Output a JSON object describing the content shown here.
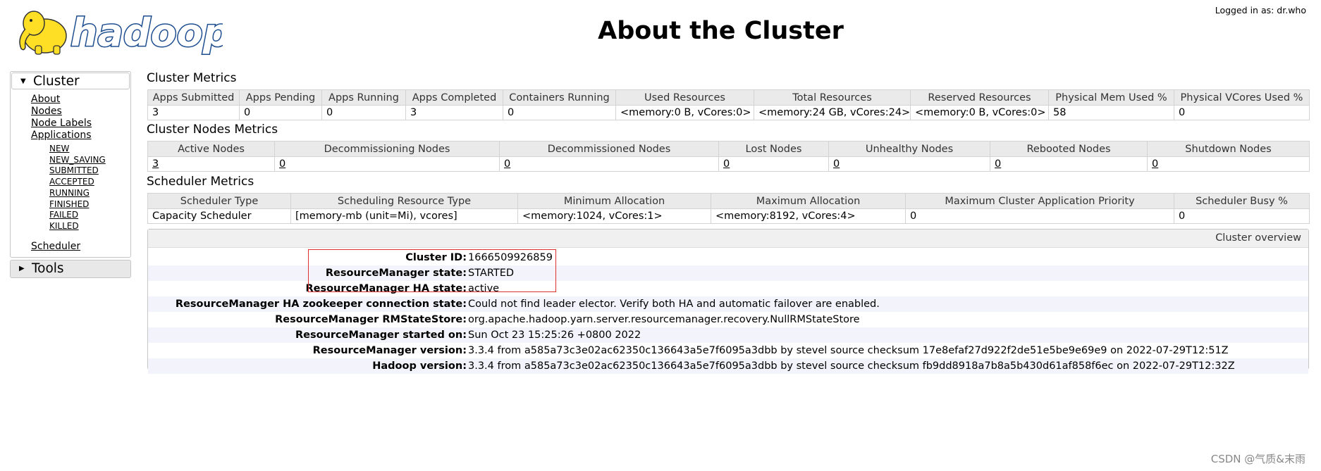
{
  "header": {
    "logo_text": "hadoop",
    "title": "About the Cluster",
    "logged_in": "Logged in as: dr.who"
  },
  "sidebar": {
    "cluster_label": "Cluster",
    "links": [
      "About",
      "Nodes",
      "Node Labels",
      "Applications"
    ],
    "app_states": [
      "NEW",
      "NEW_SAVING",
      "SUBMITTED",
      "ACCEPTED",
      "RUNNING",
      "FINISHED",
      "FAILED",
      "KILLED"
    ],
    "scheduler_label": "Scheduler",
    "tools_label": "Tools"
  },
  "cluster_metrics": {
    "title": "Cluster Metrics",
    "headers": [
      "Apps Submitted",
      "Apps Pending",
      "Apps Running",
      "Apps Completed",
      "Containers Running",
      "Used Resources",
      "Total Resources",
      "Reserved Resources",
      "Physical Mem Used %",
      "Physical VCores Used %"
    ],
    "values": [
      "3",
      "0",
      "0",
      "3",
      "0",
      "<memory:0 B, vCores:0>",
      "<memory:24 GB, vCores:24>",
      "<memory:0 B, vCores:0>",
      "58",
      "0"
    ]
  },
  "node_metrics": {
    "title": "Cluster Nodes Metrics",
    "headers": [
      "Active Nodes",
      "Decommissioning Nodes",
      "Decommissioned Nodes",
      "Lost Nodes",
      "Unhealthy Nodes",
      "Rebooted Nodes",
      "Shutdown Nodes"
    ],
    "values": [
      "3",
      "0",
      "0",
      "0",
      "0",
      "0",
      "0"
    ]
  },
  "scheduler_metrics": {
    "title": "Scheduler Metrics",
    "headers": [
      "Scheduler Type",
      "Scheduling Resource Type",
      "Minimum Allocation",
      "Maximum Allocation",
      "Maximum Cluster Application Priority",
      "Scheduler Busy %"
    ],
    "values": [
      "Capacity Scheduler",
      "[memory-mb (unit=Mi), vcores]",
      "<memory:1024, vCores:1>",
      "<memory:8192, vCores:4>",
      "0",
      "0"
    ]
  },
  "overview": {
    "header": "Cluster overview",
    "rows": [
      {
        "label": "Cluster ID:",
        "value": "1666509926859"
      },
      {
        "label": "ResourceManager state:",
        "value": "STARTED"
      },
      {
        "label": "ResourceManager HA state:",
        "value": "active"
      },
      {
        "label": "ResourceManager HA zookeeper connection state:",
        "value": "Could not find leader elector. Verify both HA and automatic failover are enabled."
      },
      {
        "label": "ResourceManager RMStateStore:",
        "value": "org.apache.hadoop.yarn.server.resourcemanager.recovery.NullRMStateStore"
      },
      {
        "label": "ResourceManager started on:",
        "value": "Sun Oct 23 15:25:26 +0800 2022"
      },
      {
        "label": "ResourceManager version:",
        "value": "3.3.4 from a585a73c3e02ac62350c136643a5e7f6095a3dbb by stevel source checksum 17e8efaf27d922f2de51e5be9e69e9 on 2022-07-29T12:51Z"
      },
      {
        "label": "Hadoop version:",
        "value": "3.3.4 from a585a73c3e02ac62350c136643a5e7f6095a3dbb by stevel source checksum fb9dd8918a7b8a5b430d61af858f6ec on 2022-07-29T12:32Z"
      }
    ]
  },
  "watermark": "CSDN @气质&末雨",
  "colors": {
    "logo_yellow": "#ffde26",
    "logo_blue": "#1d4d8f",
    "highlight_box": "#e03030"
  }
}
